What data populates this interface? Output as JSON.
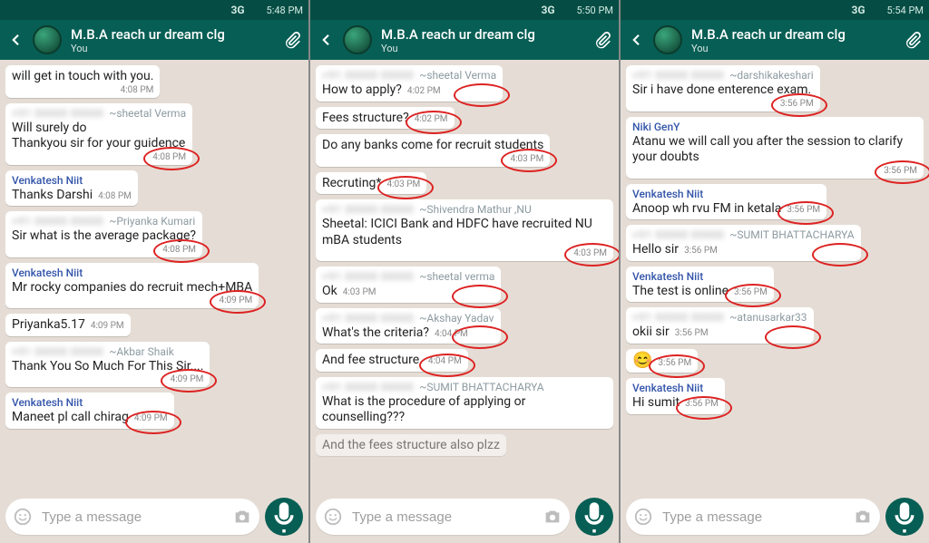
{
  "panes": [
    {
      "status": {
        "time": "5:48 PM",
        "net": "3G",
        "muted": false,
        "left_icons": 2
      },
      "header": {
        "title": "M.B.A  reach ur dream clg",
        "subtitle": "You"
      },
      "messages": [
        {
          "sender": null,
          "name": null,
          "lines": [
            "will get in touch with you."
          ],
          "time": "4:08 PM",
          "circled": false,
          "continuation": true
        },
        {
          "sender": "hidden",
          "name": "~sheetal Verma",
          "lines": [
            "Will surely do",
            "Thankyou sir for your guidence"
          ],
          "time": "4:08 PM",
          "circled": true
        },
        {
          "sender": "Venkatesh Niit",
          "name": null,
          "lines": [
            "Thanks Darshi"
          ],
          "time": "4:08 PM",
          "circled": false,
          "inline_time": true
        },
        {
          "sender": "hidden",
          "name": "~Priyanka Kumari",
          "lines": [
            "Sir what is the average package?"
          ],
          "time": "4:08 PM",
          "circled": true
        },
        {
          "sender": "Venkatesh Niit",
          "name": null,
          "lines": [
            "Mr rocky companies do recruit mech+MBA"
          ],
          "time": "4:09 PM",
          "circled": true
        },
        {
          "sender": null,
          "name": null,
          "lines": [
            "Priyanka5.17"
          ],
          "time": "4:09 PM",
          "circled": false,
          "continuation": true,
          "inline_time": true
        },
        {
          "sender": "hidden",
          "name": "~Akbar Shaik",
          "lines": [
            "Thank You So Much For This Sir...."
          ],
          "time": "4:09 PM",
          "circled": true
        },
        {
          "sender": "Venkatesh Niit",
          "name": null,
          "lines": [
            "Maneet pl call chirag"
          ],
          "time": "4:09 PM",
          "circled": true,
          "inline_time": true
        }
      ],
      "input": {
        "placeholder": "Type a message"
      }
    },
    {
      "status": {
        "time": "5:50 PM",
        "net": "3G",
        "muted": true,
        "left_icons": 0
      },
      "header": {
        "title": "M.B.A  reach ur dream clg",
        "subtitle": "You"
      },
      "messages": [
        {
          "sender": "hidden",
          "name": "~sheetal Verma",
          "lines": [
            "How to apply?"
          ],
          "time": "4:02 PM",
          "circled": true,
          "inline_time": true
        },
        {
          "sender": null,
          "name": null,
          "lines": [
            "Fees structure?"
          ],
          "time": "4:02 PM",
          "circled": true,
          "continuation": true,
          "inline_time": true
        },
        {
          "sender": null,
          "name": null,
          "lines": [
            "Do any banks come for recruit students"
          ],
          "time": "4:03 PM",
          "circled": true,
          "continuation": true
        },
        {
          "sender": null,
          "name": null,
          "lines": [
            "Recruting*"
          ],
          "time": "4:03 PM",
          "circled": true,
          "continuation": true,
          "inline_time": true
        },
        {
          "sender": "hidden",
          "name": "~Shivendra Mathur ,NU",
          "lines": [
            "Sheetal: ICICI Bank and HDFC have recruited NU mBA students"
          ],
          "time": "4:03 PM",
          "circled": true
        },
        {
          "sender": "hidden",
          "name": "~sheetal verma",
          "lines": [
            "Ok"
          ],
          "time": "4:03 PM",
          "circled": true,
          "inline_time": true
        },
        {
          "sender": "hidden",
          "name": "~Akshay Yadav",
          "lines": [
            "What's the criteria?"
          ],
          "time": "4:04 PM",
          "circled": true,
          "inline_time": true
        },
        {
          "sender": null,
          "name": null,
          "lines": [
            "And fee structure."
          ],
          "time": "4:04 PM",
          "circled": true,
          "continuation": true,
          "inline_time": true
        },
        {
          "sender": "hidden",
          "name": "~SUMIT BHATTACHARYA",
          "lines": [
            "What is the procedure of applying or counselling???"
          ],
          "time": "",
          "circled": false
        },
        {
          "sender": null,
          "name": null,
          "lines": [
            "And the fees structure also plzz"
          ],
          "time": "",
          "circled": false,
          "continuation": true,
          "cut": true
        }
      ],
      "input": {
        "placeholder": "Type a message"
      }
    },
    {
      "status": {
        "time": "5:54 PM",
        "net": "3G",
        "muted": true,
        "left_icons": 2
      },
      "header": {
        "title": "M.B.A  reach ur dream clg",
        "subtitle": "You"
      },
      "messages": [
        {
          "sender": "hidden",
          "name": "~darshikakeshari",
          "lines": [
            "Sir i have done enterence exam."
          ],
          "time": "3:56 PM",
          "circled": true
        },
        {
          "sender": "Niki GenY",
          "name": null,
          "lines": [
            "Atanu we will call you after the session to clarify your doubts"
          ],
          "time": "3:56 PM",
          "circled": true
        },
        {
          "sender": "Venkatesh Niit",
          "name": null,
          "lines": [
            "Anoop wh rvu FM in ketala"
          ],
          "time": "3:56 PM",
          "circled": true,
          "inline_time": true
        },
        {
          "sender": "hidden",
          "name": "~SUMIT BHATTACHARYA",
          "lines": [
            "Hello sir"
          ],
          "time": "3:56 PM",
          "circled": true,
          "inline_time": true
        },
        {
          "sender": "Venkatesh Niit",
          "name": null,
          "lines": [
            "The test is online"
          ],
          "time": "3:56 PM",
          "circled": true,
          "inline_time": true
        },
        {
          "sender": "hidden",
          "name": "~atanusarkar33",
          "lines": [
            "okii sir"
          ],
          "time": "3:56 PM",
          "circled": true,
          "inline_time": true
        },
        {
          "sender": null,
          "name": null,
          "lines": [
            ""
          ],
          "time": "3:56 PM",
          "circled": true,
          "continuation": true,
          "emoji": "😊",
          "inline_time": true
        },
        {
          "sender": "Venkatesh Niit",
          "name": null,
          "lines": [
            "Hi sumit"
          ],
          "time": "3:56 PM",
          "circled": true,
          "inline_time": true
        }
      ],
      "input": {
        "placeholder": "Type a message"
      }
    }
  ],
  "icons": {
    "mute": "mute-icon",
    "signal": "signal-icon",
    "wifi": "wifi-icon",
    "battery": "battery-icon"
  }
}
